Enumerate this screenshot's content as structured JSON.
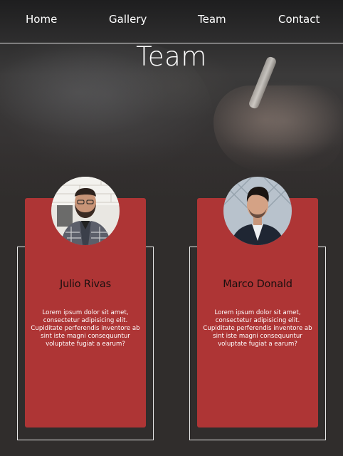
{
  "nav": {
    "items": [
      {
        "label": "Home"
      },
      {
        "label": "Gallery"
      },
      {
        "label": "Team"
      },
      {
        "label": "Contact"
      }
    ]
  },
  "page": {
    "title": "Team"
  },
  "team": {
    "members": [
      {
        "name": "Julio Rivas",
        "bio": "Lorem ipsum dolor sit amet, consectetur adipisicing elit. Cupiditate perferendis inventore ab sint iste magni consequuntur voluptate fugiat a earum?"
      },
      {
        "name": "Marco Donald",
        "bio": "Lorem ipsum dolor sit amet, consectetur adipisicing elit. Cupiditate perferendis inventore ab sint iste magni consequuntur voluptate fugiat a earum?"
      }
    ]
  },
  "colors": {
    "card": "#ae3535",
    "background": "#302d2c",
    "outline": "#e9e9e9"
  }
}
